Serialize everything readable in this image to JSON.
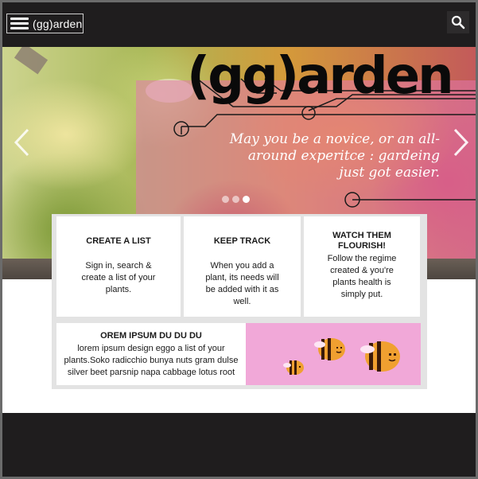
{
  "header": {
    "brand_label": "(gg)arden",
    "icons": {
      "menu": "hamburger-menu-icon",
      "search": "search-icon"
    }
  },
  "hero": {
    "title": "(gg)arden",
    "tagline": "May you be a novice, or an all-around experitce : gardeing just got easier.",
    "slide_count": 3,
    "active_slide": 3,
    "icons": {
      "prev": "chevron-left-icon",
      "next": "chevron-right-icon"
    }
  },
  "features": [
    {
      "title": "CREATE A LIST",
      "body": "Sign in, search & create a list of your plants."
    },
    {
      "title": "KEEP TRACK",
      "body": "When you add a plant, its needs will be added with it as well."
    },
    {
      "title": "WATCH THEM FLOURISH!",
      "body": "Follow the regime created & you're plants health is simply put."
    }
  ],
  "promo": {
    "title": "OREM IPSUM DU DU DU",
    "body": "lorem ipsum design eggo a list of your plants.Soko radicchio bunya nuts gram dulse silver beet parsnip napa cabbage lotus root",
    "image_icon": "bee-illustration"
  },
  "colors": {
    "header_bg": "#1f1d1e",
    "pink_overlay": "#e478af",
    "promo_pink": "#f1a8d8",
    "bee_orange": "#f0a030"
  }
}
